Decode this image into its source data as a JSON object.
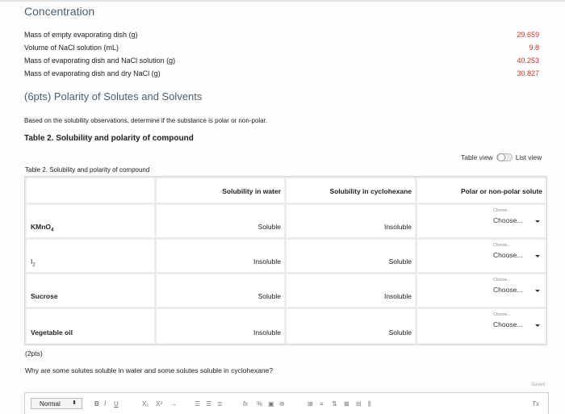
{
  "concentration": {
    "heading": "Concentration",
    "rows": [
      {
        "label": "Mass of empty evaporating dish (g)",
        "value": "29.659"
      },
      {
        "label": "Volume of NaCl solution (mL)",
        "value": "9.8"
      },
      {
        "label": "Mass of evaporating dish and NaCl solution (g)",
        "value": "40.253"
      },
      {
        "label": "Mass of evaporating dish and dry NaCl (g)",
        "value": "30.827"
      }
    ]
  },
  "polarity": {
    "heading": "(6pts) Polarity of Solutes and Solvents",
    "intro": "Based on the solubility observations, determine if the substance is polar or non-polar.",
    "table_title": "Table 2. Solubility and polarity of compound",
    "view_toggle": {
      "table_view": "Table view",
      "list_view": "List view"
    },
    "caption": "Table 2. Solubility and polarity of compound",
    "headers": [
      "",
      "Solubility in water",
      "Solubility in cyclohexane",
      "Polar or non-polar solute"
    ],
    "rows": [
      {
        "compound": "KMnO",
        "sub": "4",
        "water": "Soluble",
        "cyclohexane": "Insoluble",
        "choose_small": "Choose...",
        "choose": "Choose..."
      },
      {
        "compound": "I",
        "sub": "2",
        "water": "Insoluble",
        "cyclohexane": "Soluble",
        "choose_small": "Choose...",
        "choose": "Choose..."
      },
      {
        "compound": "Sucrose",
        "sub": "",
        "water": "Soluble",
        "cyclohexane": "Insoluble",
        "choose_small": "Choose...",
        "choose": "Choose..."
      },
      {
        "compound": "Vegetable oil",
        "sub": "",
        "water": "Insoluble",
        "cyclohexane": "Soluble",
        "choose_small": "Choose...",
        "choose": "Choose..."
      }
    ]
  },
  "question": {
    "points": "(2pts)",
    "text": "Why are some solutes soluble in water and some solutes soluble in cyclohexane?",
    "saved": "Saved"
  },
  "editor": {
    "format_label": "Normal",
    "tools": [
      "B",
      "I",
      "U",
      "X₂",
      "X²",
      "→",
      "☰",
      "☰",
      "≣",
      "fx",
      "%",
      "▣",
      "⊖",
      "⊞",
      "≡",
      "⇅",
      "⊠",
      "⊟",
      "⫼"
    ],
    "clear_format": "Tx"
  }
}
